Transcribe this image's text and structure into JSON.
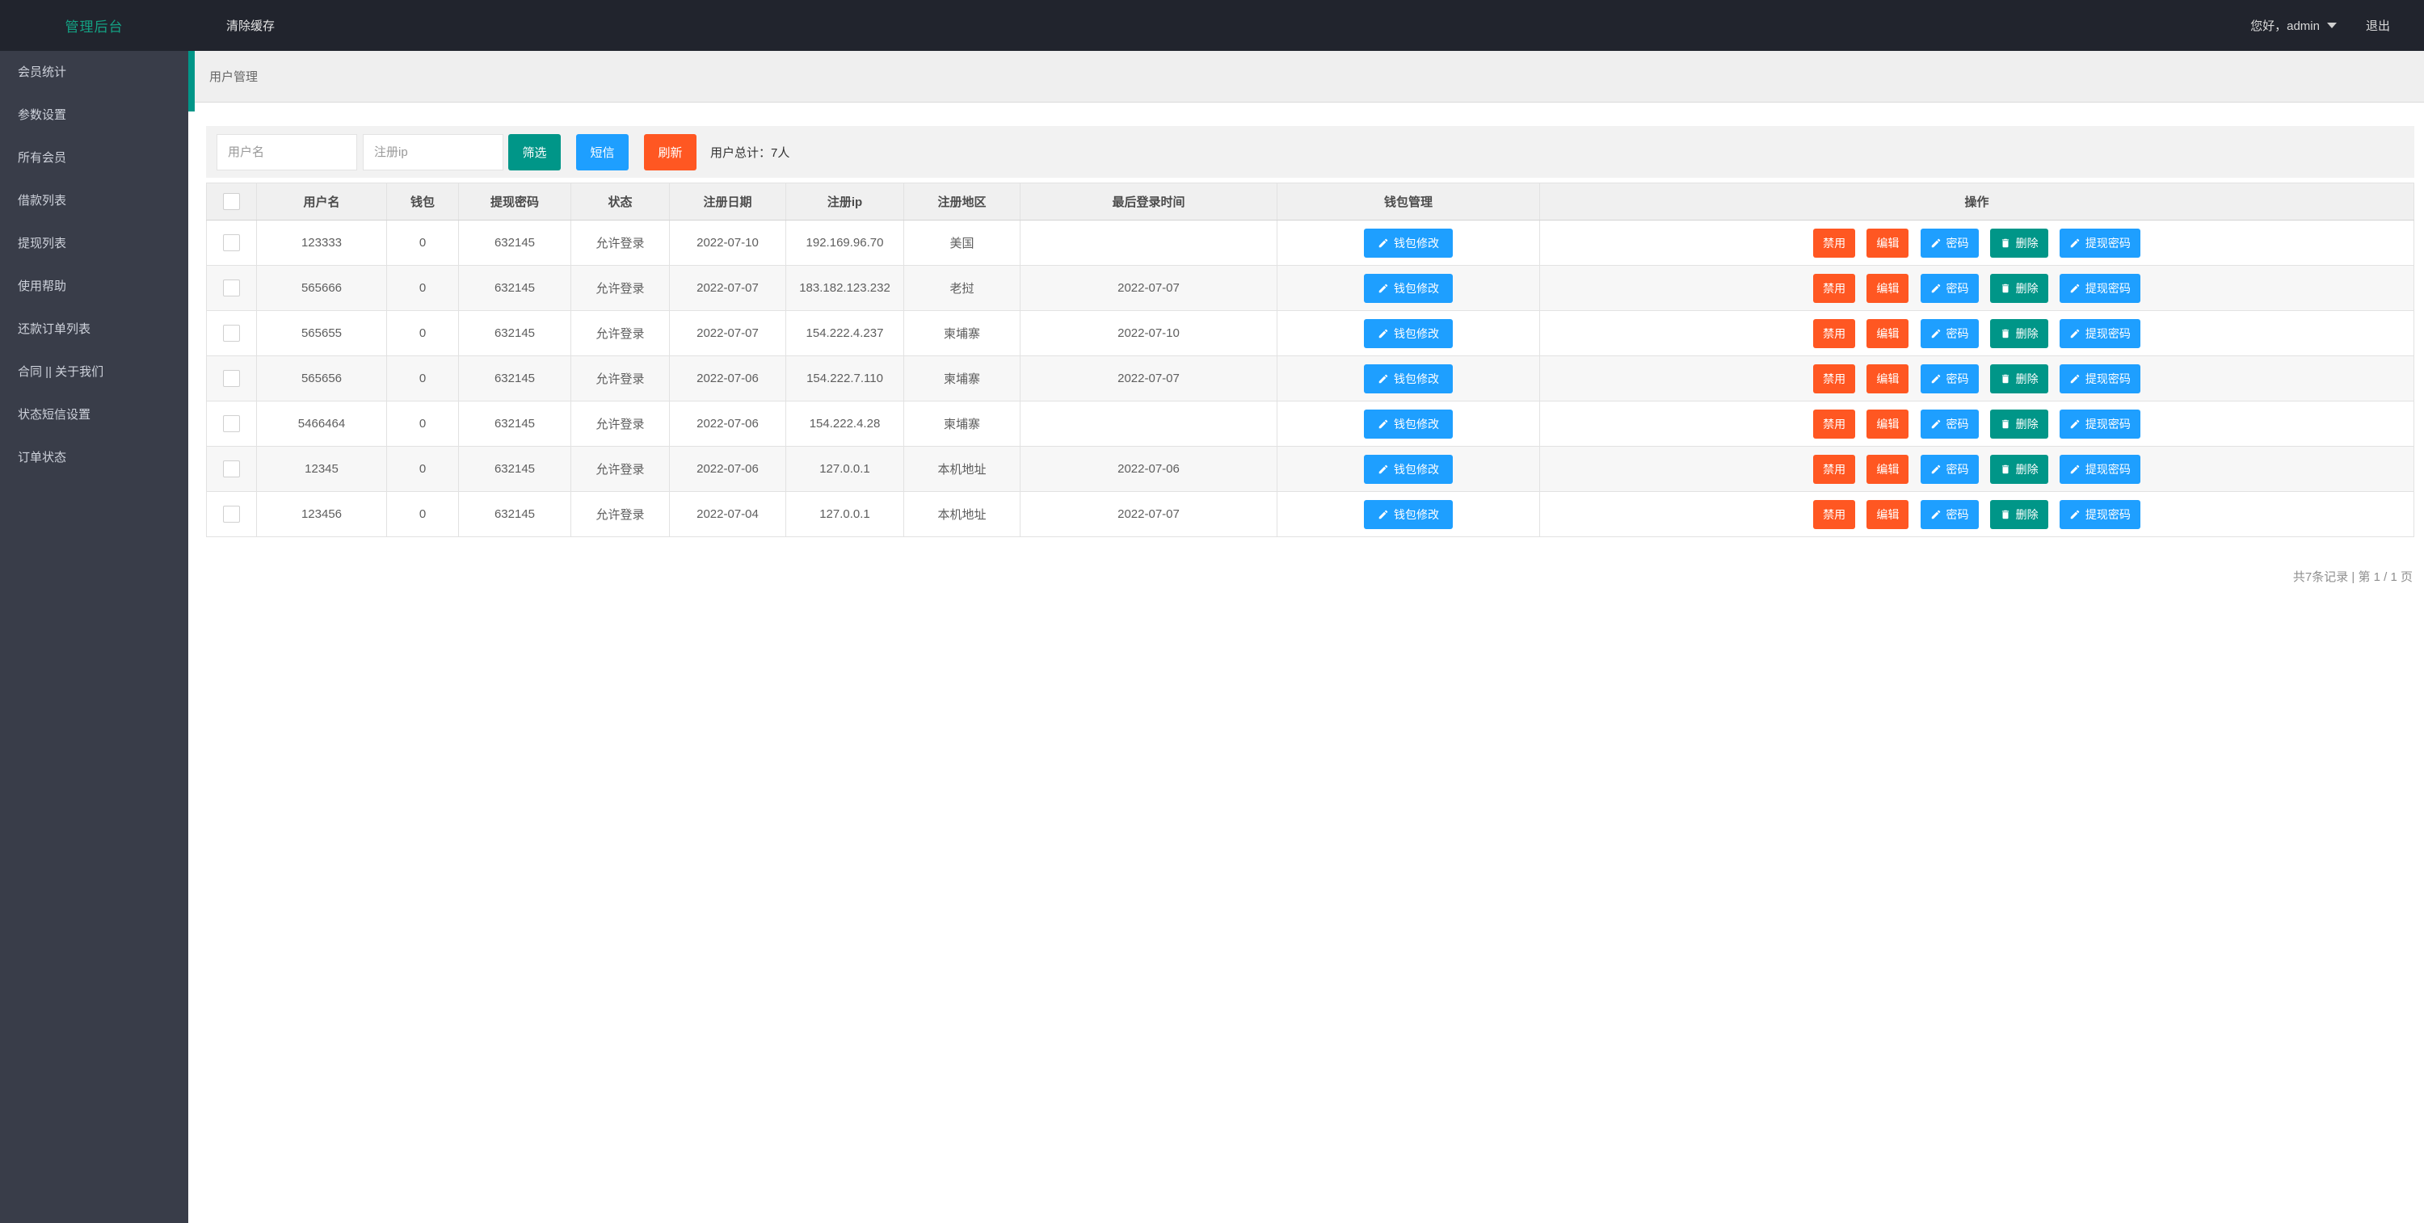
{
  "topbar": {
    "brand": "管理后台",
    "clear_cache": "清除缓存",
    "greeting": "您好，admin",
    "logout": "退出"
  },
  "sidebar": {
    "items": [
      {
        "label": "会员统计"
      },
      {
        "label": "参数设置"
      },
      {
        "label": "所有会员"
      },
      {
        "label": "借款列表"
      },
      {
        "label": "提现列表"
      },
      {
        "label": "使用帮助"
      },
      {
        "label": "还款订单列表"
      },
      {
        "label": "合同 || 关于我们"
      },
      {
        "label": "状态短信设置"
      },
      {
        "label": "订单状态"
      }
    ]
  },
  "tab": {
    "title": "用户管理"
  },
  "filter": {
    "username_placeholder": "用户名",
    "ip_placeholder": "注册ip",
    "filter_button": "筛选",
    "sms_button": "短信",
    "refresh_button": "刷新",
    "total_label": "用户总计：7人"
  },
  "table": {
    "headers": [
      "用户名",
      "钱包",
      "提现密码",
      "状态",
      "注册日期",
      "注册ip",
      "注册地区",
      "最后登录时间",
      "钱包管理",
      "操作"
    ],
    "wallet_edit_label": "钱包修改",
    "actions": {
      "disable": "禁用",
      "edit": "编辑",
      "password": "密码",
      "delete": "删除",
      "withdraw_password": "提现密码"
    },
    "rows": [
      {
        "username": "123333",
        "wallet": "0",
        "withdraw_password": "632145",
        "status": "允许登录",
        "register_date": "2022-07-10",
        "register_ip": "192.169.96.70",
        "register_region": "美国",
        "last_login": ""
      },
      {
        "username": "565666",
        "wallet": "0",
        "withdraw_password": "632145",
        "status": "允许登录",
        "register_date": "2022-07-07",
        "register_ip": "183.182.123.232",
        "register_region": "老挝",
        "last_login": "2022-07-07"
      },
      {
        "username": "565655",
        "wallet": "0",
        "withdraw_password": "632145",
        "status": "允许登录",
        "register_date": "2022-07-07",
        "register_ip": "154.222.4.237",
        "register_region": "柬埔寨",
        "last_login": "2022-07-10"
      },
      {
        "username": "565656",
        "wallet": "0",
        "withdraw_password": "632145",
        "status": "允许登录",
        "register_date": "2022-07-06",
        "register_ip": "154.222.7.110",
        "register_region": "柬埔寨",
        "last_login": "2022-07-07"
      },
      {
        "username": "5466464",
        "wallet": "0",
        "withdraw_password": "632145",
        "status": "允许登录",
        "register_date": "2022-07-06",
        "register_ip": "154.222.4.28",
        "register_region": "柬埔寨",
        "last_login": ""
      },
      {
        "username": "12345",
        "wallet": "0",
        "withdraw_password": "632145",
        "status": "允许登录",
        "register_date": "2022-07-06",
        "register_ip": "127.0.0.1",
        "register_region": "本机地址",
        "last_login": "2022-07-06"
      },
      {
        "username": "123456",
        "wallet": "0",
        "withdraw_password": "632145",
        "status": "允许登录",
        "register_date": "2022-07-04",
        "register_ip": "127.0.0.1",
        "register_region": "本机地址",
        "last_login": "2022-07-07"
      }
    ]
  },
  "pagination": {
    "summary": "共7条记录 | 第 1 / 1 页"
  },
  "colors": {
    "teal": "#009688",
    "blue": "#1E9FFF",
    "orange": "#FF5722"
  }
}
